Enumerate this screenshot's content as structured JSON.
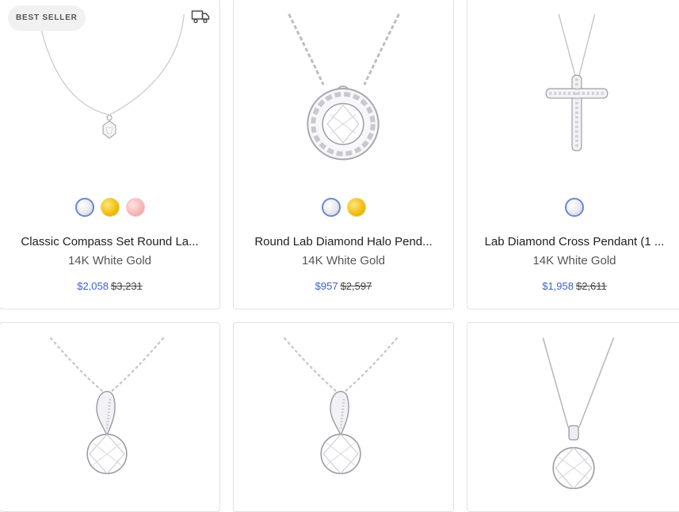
{
  "products": [
    {
      "badge": "BEST SELLER",
      "title": "Classic Compass Set Round La...",
      "metal": "14K White Gold",
      "sale_price": "$2,058",
      "regular_price": "$3,231",
      "swatches": [
        "white-gold",
        "yellow-gold",
        "rose-gold"
      ]
    },
    {
      "title": "Round Lab Diamond Halo Pend...",
      "metal": "14K White Gold",
      "sale_price": "$957",
      "regular_price": "$2,597",
      "swatches": [
        "white-gold",
        "yellow-gold"
      ]
    },
    {
      "title": "Lab Diamond Cross Pendant (1 ...",
      "metal": "14K White Gold",
      "sale_price": "$1,958",
      "regular_price": "$2,611",
      "swatches": [
        "white-gold"
      ]
    },
    {
      "image": "twist-bail-solitaire-pendant"
    },
    {
      "image": "twist-bail-solitaire-pendant"
    },
    {
      "image": "solitaire-pendant-box-chain"
    }
  ],
  "colors": {
    "accent": "#3e63c8",
    "white_gold_ring": "#6a86d8",
    "yellow_gold": "#f2c014",
    "rose_gold": "#f6b8b8",
    "card_border": "#e2e2e2"
  },
  "icons": {
    "shipping": "truck-icon"
  }
}
